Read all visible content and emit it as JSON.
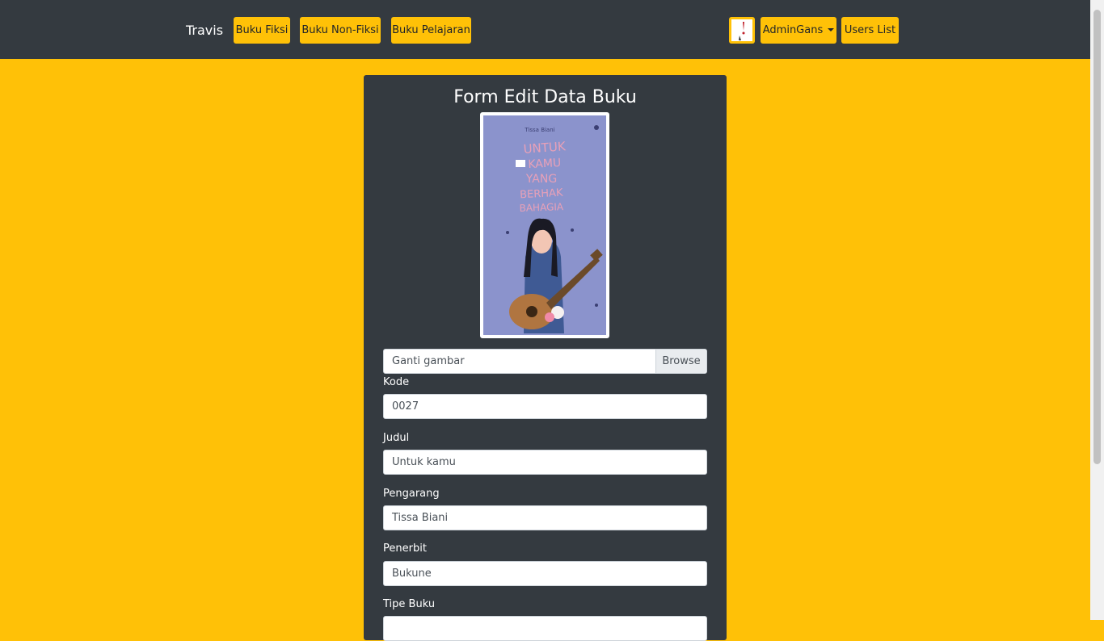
{
  "navbar": {
    "brand": "Travis",
    "links": [
      "Buku Fiksi",
      "Buku Non-Fiksi",
      "Buku Pelajaran"
    ],
    "user_menu": "AdminGans",
    "users_list": "Users List"
  },
  "form": {
    "title": "Form Edit Data Buku",
    "cover_text": {
      "author": "Tissa Biani",
      "title_lines": [
        "UNTUK",
        "KAMU",
        "YANG",
        "BERHAK",
        "BAHAGIA"
      ]
    },
    "file_input": {
      "placeholder": "Ganti gambar",
      "browse": "Browse"
    },
    "fields": [
      {
        "label": "Kode",
        "value": "0027"
      },
      {
        "label": "Judul",
        "value": "Untuk kamu"
      },
      {
        "label": "Pengarang",
        "value": "Tissa Biani"
      },
      {
        "label": "Penerbit",
        "value": "Bukune"
      },
      {
        "label": "Tipe Buku",
        "value": ""
      }
    ]
  },
  "colors": {
    "background": "#ffc107",
    "navbar": "#343a40",
    "accent": "#ffc107",
    "card": "#343a40"
  }
}
